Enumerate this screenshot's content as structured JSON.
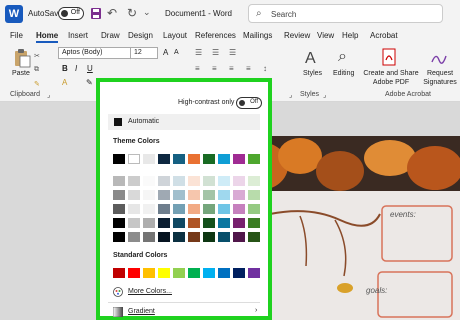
{
  "titlebar": {
    "autosave_label": "AutoSave",
    "autosave_state": "Off",
    "doc_title": "Document1 - Word",
    "search_placeholder": "Search"
  },
  "tabs": [
    "File",
    "Home",
    "Insert",
    "Draw",
    "Design",
    "Layout",
    "References",
    "Mailings",
    "Review",
    "View",
    "Help",
    "Acrobat"
  ],
  "active_tab": "Home",
  "ribbon": {
    "font_name": "Aptos (Body)",
    "font_size": "12",
    "paste_label": "Paste",
    "clipboard_label": "Clipboard",
    "styles_label": "Styles",
    "styles_group_label": "Styles",
    "editing_label": "Editing",
    "create_pdf_label": "Create and Share Adobe PDF",
    "request_sig_label": "Request Signatures",
    "acrobat_group_label": "Adobe Acrobat"
  },
  "dropdown": {
    "high_contrast_label": "High-contrast only",
    "high_contrast_state": "Off",
    "automatic_label": "Automatic",
    "theme_colors_label": "Theme Colors",
    "standard_colors_label": "Standard Colors",
    "more_colors_label": "More Colors...",
    "gradient_label": "Gradient"
  },
  "document": {
    "events_label": "events:",
    "goals_label": "goals:"
  },
  "colors": {
    "highlight_border": "#1fd21f",
    "word_blue": "#185abd",
    "theme_base": [
      "#000000",
      "#ffffff",
      "#e8e8e8",
      "#0e2841",
      "#156082",
      "#e97132",
      "#196b24",
      "#0f9ed5",
      "#a02b93",
      "#4ea72e"
    ],
    "standard": [
      "#c00000",
      "#ff0000",
      "#ffc000",
      "#ffff00",
      "#92d050",
      "#00b050",
      "#00b0f0",
      "#0070c0",
      "#002060",
      "#7030a0"
    ]
  }
}
